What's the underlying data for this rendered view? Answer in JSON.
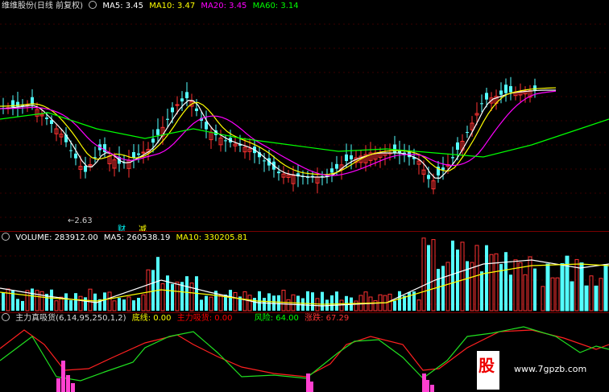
{
  "main": {
    "title": "维维股份(日线 前复权)",
    "ma5": "MA5: 3.45",
    "ma10": "MA10: 3.47",
    "ma20": "MA20: 3.45",
    "ma60": "MA60: 3.14",
    "low_label": "2.63",
    "badge1": "财",
    "badge2": "减"
  },
  "volume": {
    "title": "VOLUME: 283912.00",
    "ma5": "MA5: 260538.19",
    "ma10": "MA10: 330205.81"
  },
  "indicator": {
    "title": "主力真吸货(6,14,95,250,1,2)",
    "base": "底线: 0.00",
    "absorb": "主力吸货: 0.00",
    "risk": "风险: 64.00",
    "change": "涨跌: 67.29"
  },
  "watermark": "www.7gpzb.com",
  "logo_text": "股",
  "colors": {
    "up": "#ff3232",
    "down": "#54ffff",
    "ma5": "#ffffff",
    "ma10": "#ffff00",
    "ma20": "#ff00ff",
    "ma60": "#00ff00"
  }
}
